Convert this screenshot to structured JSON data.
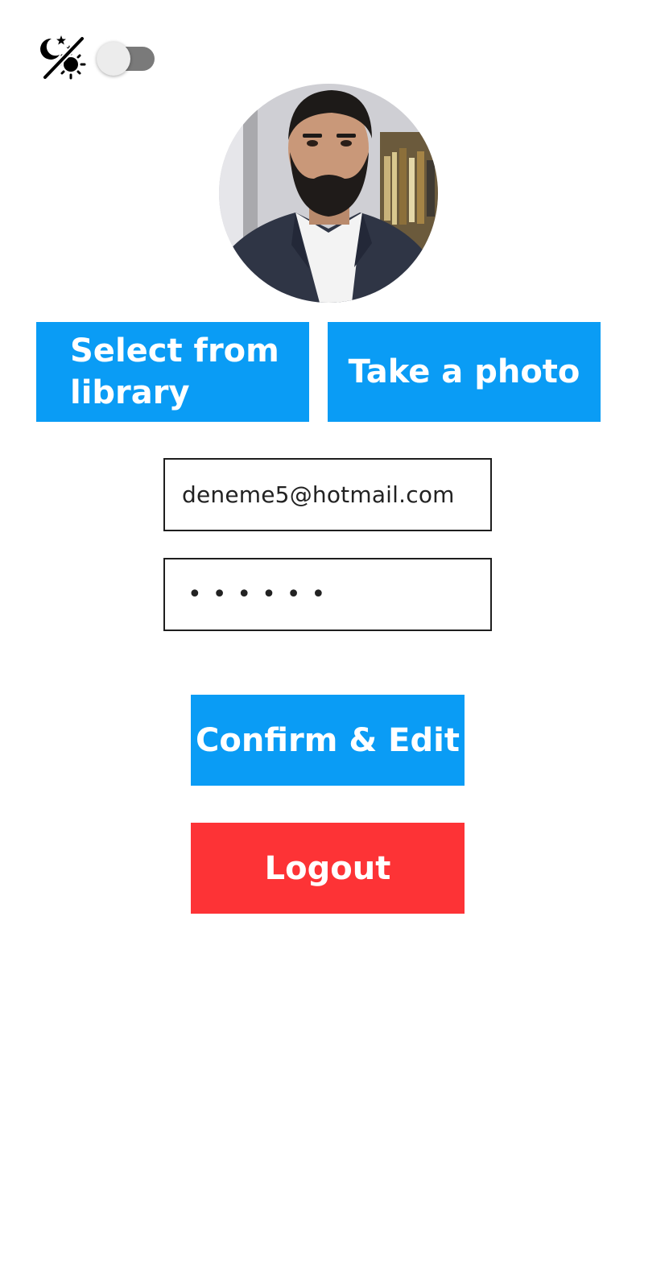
{
  "header": {
    "theme_icon": "moon-sun-crossed-icon",
    "dark_mode_toggle": {
      "state": "off"
    }
  },
  "profile": {
    "avatar": "profile-photo"
  },
  "photo_actions": {
    "library_label": "Select from library",
    "camera_label": "Take a photo"
  },
  "form": {
    "email_value": "deneme5@hotmail.com",
    "password_masked": "••••••"
  },
  "actions": {
    "confirm_label": "Confirm & Edit",
    "logout_label": "Logout"
  },
  "colors": {
    "primary": "#0a9cf5",
    "danger": "#fd3336",
    "toggle_track": "#7a7a7a",
    "toggle_thumb": "#ececec"
  }
}
